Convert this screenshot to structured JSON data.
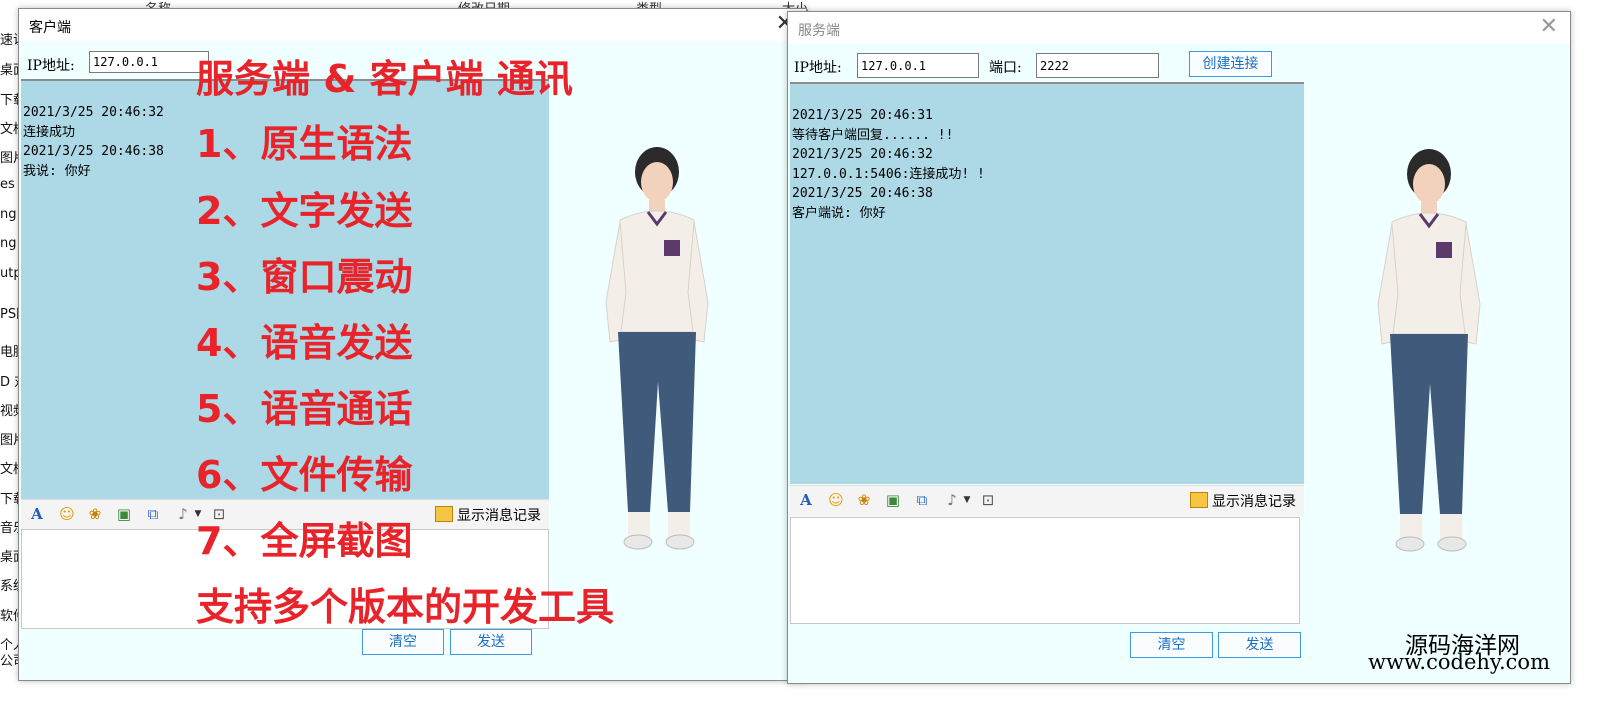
{
  "background": {
    "columns": [
      "名称",
      "修改日期",
      "类型",
      "大小"
    ],
    "nav_items": [
      "速访",
      "桌面",
      "下载",
      "文档",
      "图片",
      "es",
      "ng",
      "ng",
      "utp",
      "PS网",
      "电脑",
      "D 对",
      "视频",
      "图片",
      "文档",
      "下载",
      "音乐",
      "桌面",
      "系统",
      "软件",
      "个人"
    ],
    "drive": "公司盘 (F:)"
  },
  "client": {
    "title": "客户端",
    "ip_label": "IP地址:",
    "ip_value": "127.0.0.1",
    "chat": [
      "2021/3/25 20:46:32",
      "连接成功",
      "2021/3/25 20:46:38",
      "我说: 你好"
    ],
    "history": "显示消息记录",
    "clear": "清空",
    "send": "发送"
  },
  "server": {
    "title": "服务端",
    "ip_label": "IP地址:",
    "ip_value": "127.0.0.1",
    "port_label": "端口:",
    "port_value": "2222",
    "connect": "创建连接",
    "chat": [
      "2021/3/25 20:46:31",
      "等待客户端回复...... !!",
      "2021/3/25 20:46:32",
      "127.0.0.1:5406:连接成功! !",
      "2021/3/25 20:46:38",
      "客户端说: 你好"
    ],
    "history": "显示消息记录",
    "clear": "清空",
    "send": "发送"
  },
  "overlay": {
    "title": "服务端 & 客户端 通讯",
    "features": [
      "1、原生语法",
      "2、文字发送",
      "3、窗口震动",
      "4、语音发送",
      "5、语音通话",
      "6、文件传输",
      "7、全屏截图"
    ],
    "footer": "支持多个版本的开发工具"
  },
  "watermark": {
    "name": "源码海洋网",
    "url": "www.codehy.com"
  },
  "colors": {
    "chat_bg": "#add8e6",
    "overlay_red": "#e8232a",
    "button_border": "#3f9be0"
  },
  "toolbar_icons": [
    "font-icon",
    "emoji-icon",
    "gift-icon",
    "image-icon",
    "screenshot-icon",
    "mic-icon",
    "dropdown-icon",
    "shake-icon"
  ]
}
